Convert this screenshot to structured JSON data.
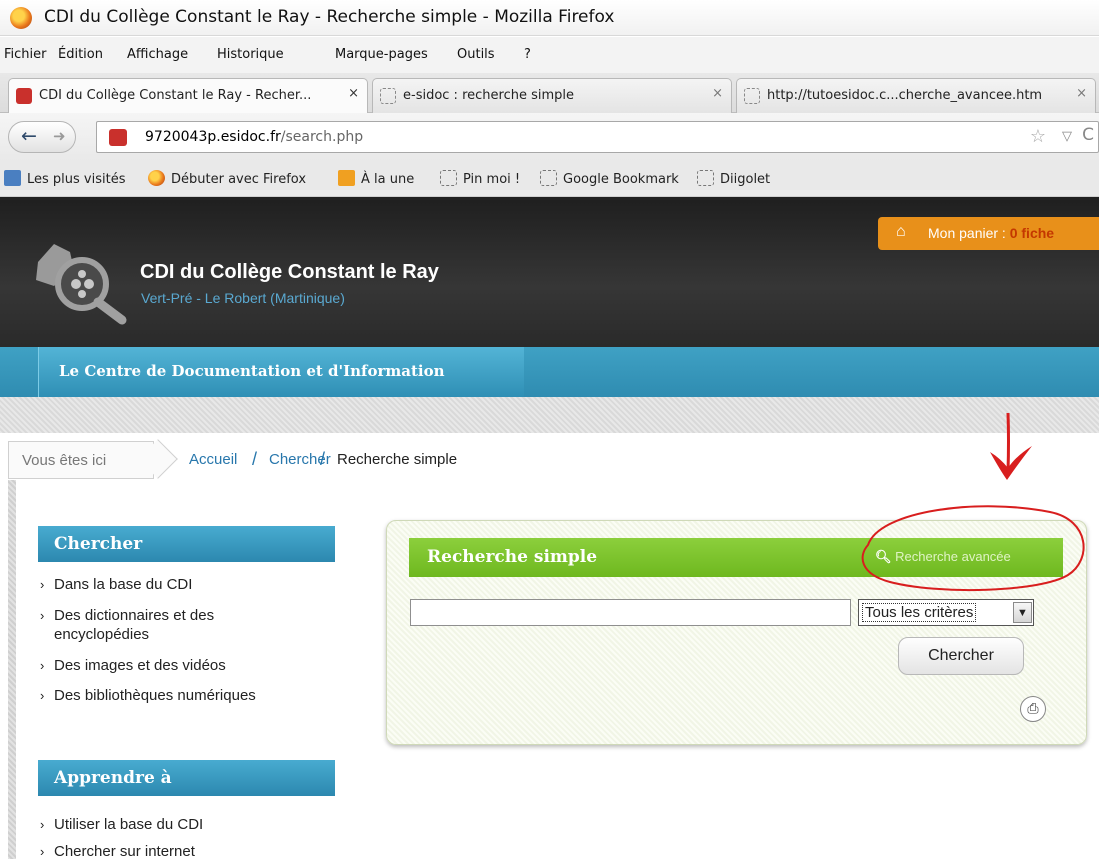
{
  "window": {
    "title": "CDI du Collège Constant le Ray - Recherche simple - Mozilla Firefox"
  },
  "menu": [
    "Fichier",
    "Édition",
    "Affichage",
    "Historique",
    "Marque-pages",
    "Outils",
    "?"
  ],
  "tabs": [
    {
      "label": "CDI du Collège Constant le Ray - Recher...",
      "close": "×"
    },
    {
      "label": "e-sidoc : recherche simple",
      "close": "×"
    },
    {
      "label": "http://tutoesidoc.c...cherche_avancee.htm",
      "close": "×"
    }
  ],
  "navbar": {
    "url_host": "9720043p.esidoc.fr",
    "url_path": "/search.php"
  },
  "bookmarks": [
    "Les plus visités",
    "Débuter avec Firefox",
    "À la une",
    "Pin moi !",
    "Google Bookmark",
    "Diigolet"
  ],
  "header": {
    "site_title": "CDI du Collège Constant le Ray",
    "site_subtitle": "Vert-Pré - Le Robert (Martinique)",
    "cart_label": "Mon panier :",
    "cart_count": "0 fiche",
    "section_label": "Le Centre de Documentation et d'Information"
  },
  "breadcrumb": {
    "here": "Vous êtes ici",
    "items": [
      "Accueil",
      "Chercher"
    ],
    "separator": "/",
    "current": "Recherche simple"
  },
  "sidebar": {
    "search_title": "Chercher",
    "search_links": [
      "Dans la base du CDI",
      "Des dictionnaires et des encyclopédies",
      "Des images et des vidéos",
      "Des bibliothèques numériques"
    ],
    "learn_title": "Apprendre à",
    "learn_links": [
      "Utiliser la base du CDI",
      "Chercher sur internet"
    ]
  },
  "search": {
    "title": "Recherche simple",
    "advanced_link": "Recherche avancée",
    "input_value": "",
    "criteria": "Tous les critères",
    "button": "Chercher"
  },
  "colors": {
    "accent_blue": "#3fa1c4",
    "search_green": "#7cc52b",
    "cart_orange": "#e8901a",
    "annotation_red": "#d81e1e"
  },
  "icons": {
    "back": "arrow-left-icon",
    "forward": "arrow-right-icon",
    "star": "star-icon",
    "reload": "reload-icon",
    "cart": "basket-icon",
    "magnifier": "magnifier-icon",
    "print": "print-icon"
  }
}
